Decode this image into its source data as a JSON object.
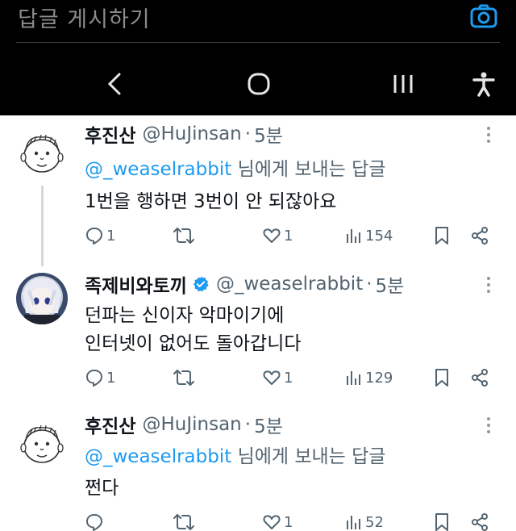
{
  "reply_bar": {
    "placeholder": "답글 게시하기",
    "camera_icon": "camera-icon"
  },
  "nav_bar": {
    "back_icon": "chevron-left-icon",
    "home_icon": "circle-home-icon",
    "recents_icon": "recent-apps-icon",
    "accessibility_icon": "accessibility-icon"
  },
  "colors": {
    "mention": "#1d9bf0",
    "muted": "#536471",
    "verified": "#1d9bf0"
  },
  "tweets": [
    {
      "name": "후진산",
      "handle": "@HuJinsan",
      "time": "5분",
      "reply_to_handle": "@_weaselrabbit",
      "reply_to_suffix": "님에게 보내는 답글",
      "lines": [
        "1번을 행하면 3번이 안 되잖아요"
      ],
      "replies": "1",
      "retweets": "",
      "likes": "1",
      "views": "154"
    },
    {
      "name": "족제비와토끼",
      "verified": true,
      "handle": "@_weaselrabbit",
      "time": "5분",
      "lines": [
        "던파는 신이자 악마이기에",
        "인터넷이 없어도 돌아갑니다"
      ],
      "replies": "1",
      "retweets": "",
      "likes": "1",
      "views": "129"
    },
    {
      "name": "후진산",
      "handle": "@HuJinsan",
      "time": "5분",
      "reply_to_handle": "@_weaselrabbit",
      "reply_to_suffix": "님에게 보내는 답글",
      "lines": [
        "쩐다"
      ],
      "replies": "",
      "retweets": "",
      "likes": "1",
      "views": "52"
    }
  ]
}
